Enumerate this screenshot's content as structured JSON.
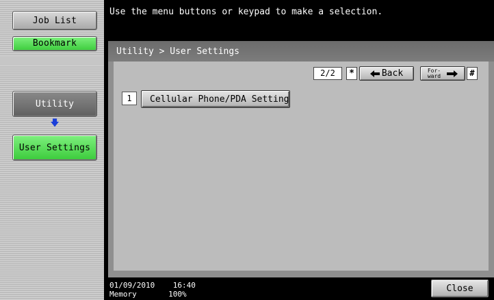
{
  "message": "Use the menu buttons or keypad to make a selection.",
  "sidebar": {
    "job_list": "Job List",
    "bookmark": "Bookmark",
    "utility": "Utility",
    "user_settings": "User Settings"
  },
  "panel": {
    "breadcrumb": "Utility > User Settings",
    "page_indicator": "2/2",
    "star_key": "*",
    "back_label": "Back",
    "forward_label_top": "For-",
    "forward_label_bottom": "ward",
    "hash_key": "#",
    "items": [
      {
        "number": "1",
        "label": "Cellular Phone/PDA Setting"
      }
    ]
  },
  "footer": {
    "date": "01/09/2010",
    "time": "16:40",
    "memory_label": "Memory",
    "memory_value": "100%",
    "close_label": "Close"
  },
  "colors": {
    "accent_green": "#3ccc3c",
    "arrow_blue": "#1a3ed8"
  }
}
